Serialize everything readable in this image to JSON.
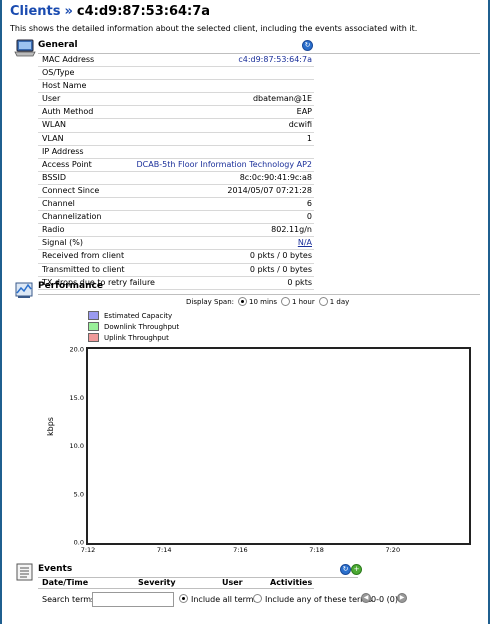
{
  "header": {
    "crumb": "Clients",
    "separator": "»",
    "mac": "c4:d9:87:53:64:7a",
    "description": "This shows the detailed information about the selected client, including the events associated with it."
  },
  "general": {
    "title": "General",
    "rows": [
      {
        "label": "MAC Address",
        "value": "c4:d9:87:53:64:7a"
      },
      {
        "label": "OS/Type",
        "value": ""
      },
      {
        "label": "Host Name",
        "value": ""
      },
      {
        "label": "User",
        "value": "dbateman@1E"
      },
      {
        "label": "Auth Method",
        "value": "EAP"
      },
      {
        "label": "WLAN",
        "value": "dcwifi"
      },
      {
        "label": "VLAN",
        "value": "1"
      },
      {
        "label": "IP Address",
        "value": ""
      },
      {
        "label": "Access Point",
        "value": "DCAB-5th Floor Information Technology AP2"
      },
      {
        "label": "BSSID",
        "value": "8c:0c:90:41:9c:a8"
      },
      {
        "label": "Connect Since",
        "value": "2014/05/07  07:21:28"
      },
      {
        "label": "Channel",
        "value": "6"
      },
      {
        "label": "Channelization",
        "value": "0"
      },
      {
        "label": "Radio",
        "value": "802.11g/n"
      },
      {
        "label": "Signal (%)",
        "value": "N/A"
      },
      {
        "label": "Received from client",
        "value": "0 pkts / 0 bytes"
      },
      {
        "label": "Transmitted to client",
        "value": "0 pkts / 0 bytes"
      },
      {
        "label": "TX drops due to retry failure",
        "value": "0 pkts"
      }
    ]
  },
  "performance": {
    "title": "Performance",
    "display_span_label": "Display Span:",
    "span_options": [
      "10 mins",
      "1 hour",
      "1 day"
    ],
    "span_selected": "10 mins",
    "legend": [
      {
        "name": "Estimated Capacity",
        "color": "#9a9af0"
      },
      {
        "name": "Downlink Throughput",
        "color": "#9af09a"
      },
      {
        "name": "Uplink Throughput",
        "color": "#f09a9a"
      }
    ]
  },
  "chart_data": {
    "type": "line",
    "ylabel": "kbps",
    "xlabel": "",
    "ylim": [
      0,
      20
    ],
    "yticks": [
      "0.0",
      "5.0",
      "10.0",
      "15.0",
      "20.0"
    ],
    "yticks_values": [
      0,
      5,
      10,
      15,
      20
    ],
    "x_tick_labels": [
      "7:12",
      "7:14",
      "7:16",
      "7:18",
      "7:20"
    ],
    "x_range_minutes": [
      0,
      10
    ],
    "x_tick_minutes": [
      0,
      2,
      4,
      6,
      8
    ],
    "grid": true,
    "series": [
      {
        "name": "Estimated Capacity",
        "values": []
      },
      {
        "name": "Downlink Throughput",
        "values": []
      },
      {
        "name": "Uplink Throughput",
        "values": []
      }
    ]
  },
  "events": {
    "title": "Events",
    "columns": [
      "Date/Time",
      "Severity",
      "User",
      "Activities"
    ],
    "search_label": "Search terms",
    "search_value": "",
    "option_all": "Include all terms",
    "option_any": "Include any of these terms",
    "pager": "0-0 (0)"
  }
}
